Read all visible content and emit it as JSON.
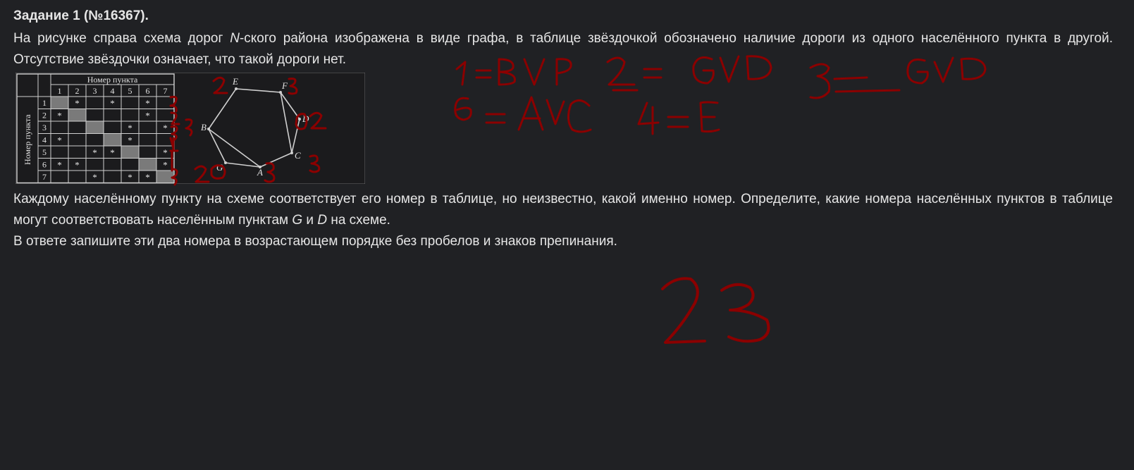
{
  "task": {
    "title": "Задание 1 (№16367).",
    "p1_part1": "На рисунке справа схема дорог ",
    "p1_var": "N",
    "p1_part2": "-ского района изображена в виде графа, в таблице звёздочкой обозначено наличие дороги из одного населённого пункта в другой. Отсутствие звёздочки означает, что такой дороги нет.",
    "p2_part1": "Каждому населённому пункту на схеме соответствует его номер в таблице, но неизвестно, какой именно номер. Определите, какие номера населённых пунктов в таблице могут соответствовать населённым пунктам ",
    "p2_var1": "G",
    "p2_and": " и ",
    "p2_var2": "D",
    "p2_part2": " на схеме.",
    "p3": "В ответе запишите эти два номера в возрастающем порядке без пробелов и знаков препинания."
  },
  "table": {
    "header_top": "Номер пункта",
    "header_side": "Номер пункта",
    "columns": [
      "1",
      "2",
      "3",
      "4",
      "5",
      "6",
      "7"
    ],
    "rows": [
      {
        "label": "1",
        "cells": [
          "",
          "*",
          "",
          "*",
          "",
          "*",
          ""
        ]
      },
      {
        "label": "2",
        "cells": [
          "*",
          "",
          "",
          "",
          "",
          "*",
          ""
        ]
      },
      {
        "label": "3",
        "cells": [
          "",
          "",
          "",
          "",
          "*",
          "",
          "*"
        ]
      },
      {
        "label": "4",
        "cells": [
          "*",
          "",
          "",
          "",
          "*",
          "",
          ""
        ]
      },
      {
        "label": "5",
        "cells": [
          "",
          "",
          "*",
          "*",
          "",
          "",
          "*"
        ]
      },
      {
        "label": "6",
        "cells": [
          "*",
          "*",
          "",
          "",
          "",
          "",
          "*"
        ]
      },
      {
        "label": "7",
        "cells": [
          "",
          "",
          "*",
          "",
          "*",
          "*",
          ""
        ]
      }
    ]
  },
  "graph": {
    "nodes": [
      "E",
      "F",
      "D",
      "B",
      "C",
      "G",
      "A"
    ]
  },
  "colors": {
    "background": "#202124",
    "text": "#e6e6e6",
    "ink": "#8b0000",
    "diag_cell": "#7a7a7a"
  }
}
